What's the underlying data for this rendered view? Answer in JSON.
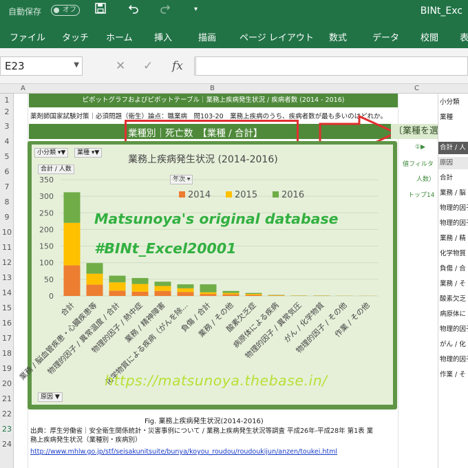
{
  "titlebar": {
    "autosave_label": "自動保存",
    "autosave_state": "オフ",
    "save_icon": "floppy-disk-icon",
    "undo_icon": "undo-icon",
    "redo_icon": "redo-icon",
    "customize_icon": "dropdown-caret-icon",
    "title": "BINt_Exc"
  },
  "ribbon": {
    "tabs": [
      "ファイル",
      "タッチ",
      "ホーム",
      "挿入",
      "描画",
      "ページ レイアウト",
      "数式",
      "データ",
      "校閲",
      "表"
    ]
  },
  "formula_bar": {
    "name_box": "E23",
    "cancel_icon": "✕",
    "enter_icon": "✓",
    "fx_label": "fx",
    "formula": ""
  },
  "columns": [
    "A",
    "B",
    "C"
  ],
  "rows": [
    "1",
    "2",
    "3",
    "4",
    "5",
    "6",
    "7",
    "8",
    "9",
    "10",
    "11",
    "12",
    "13",
    "14",
    "15",
    "16",
    "17",
    "18",
    "19",
    "20",
    "21",
    "22",
    "23",
    "24"
  ],
  "sheet": {
    "banner_row1": "ピボットグラフおよびピボットテーブル｜業務上疾病発生状況 / 疾病者数 (2014 - 2016)",
    "row2_text": "薬剤師国家試験対策｜必須問題（衛生）論点：職業病　問103-20　業務上疾病のうち、疾病者数が最も多いのはどれか。",
    "banner_row3": "業種別｜死亡数　【業種 / 合計】",
    "select_hint": "〔業種を選択で",
    "caption": "Fig. 業務上疾病発生状況(2014-2016)",
    "source_line1": "出典：厚生労働省｜安全衛生関係統計・災害事例について / 業務上疾病発生状況等調査 平成26年-平成28年 第1表 業",
    "source_line2": "務上疾病発生状況（業種別・疾病別）",
    "link": "http://www.mhlw.go.jp/stf/seisakunitsuite/bunya/koyou_roudou/roudoukijun/anzen/toukei.html"
  },
  "pivot_buttons": {
    "category": "小分類",
    "industry": "業種",
    "value": "合計 / 人数",
    "year": "年次",
    "cause": "原因"
  },
  "watermarks": {
    "line1": "Matsunoya's original database",
    "line2": "#BINt_Excel20001",
    "url": "https://matsunoya.thebase.in/"
  },
  "side_labels": {
    "row_indicator": "①▶",
    "value_filter": "値フィルタ",
    "people": "人数）",
    "top14": "トップ14"
  },
  "panel": {
    "items": [
      "小分類",
      "業種",
      "合計 / 人",
      "原因",
      "合計",
      "業務 / 脳",
      "物理的因子",
      "物理的因子",
      "業務 / 精",
      "化学物質",
      "負傷 / 合",
      "業務 / そ",
      "酸素欠乏",
      "病原体に",
      "物理的因子",
      "がん / 化",
      "物理的因子",
      "作業 / そ"
    ]
  },
  "chart_data": {
    "type": "bar",
    "stacked": true,
    "title": "業務上疾病発生状況 (2014-2016)",
    "ylabel": "合計 / 人数",
    "ylim": [
      0,
      350
    ],
    "yticks": [
      0,
      50,
      100,
      150,
      200,
      250,
      300,
      350
    ],
    "legend_title": "年次",
    "legend_position": "top",
    "categories": [
      "合計",
      "業務 / 脳血管疾患・心臓疾患等",
      "物理的因子 / 異常温度 / 合計",
      "物理的因子 / 熱中症",
      "業務 / 精神障害",
      "化学物質による疾病（がんを除...",
      "負傷 / 合計",
      "業務 / その他",
      "酸素欠乏症",
      "病原体による疾病",
      "物理的因子 / 異常気圧",
      "がん / 化学物質",
      "物理的因子 / その他",
      "作業 / その他"
    ],
    "series": [
      {
        "name": "2014",
        "color": "#ed7d31",
        "values": [
          92,
          34,
          16,
          13,
          15,
          12,
          6,
          5,
          3,
          1,
          0.5,
          0.5,
          0.3,
          0.2
        ]
      },
      {
        "name": "2015",
        "color": "#ffc000",
        "values": [
          128,
          33,
          25,
          23,
          15,
          11,
          5,
          4,
          3,
          1,
          0.5,
          0.5,
          0.3,
          0.2
        ]
      },
      {
        "name": "2016",
        "color": "#70ad47",
        "values": [
          92,
          32,
          20,
          18,
          13,
          12,
          24,
          6,
          3,
          1,
          0.5,
          0.5,
          0.3,
          0.2
        ]
      }
    ]
  }
}
